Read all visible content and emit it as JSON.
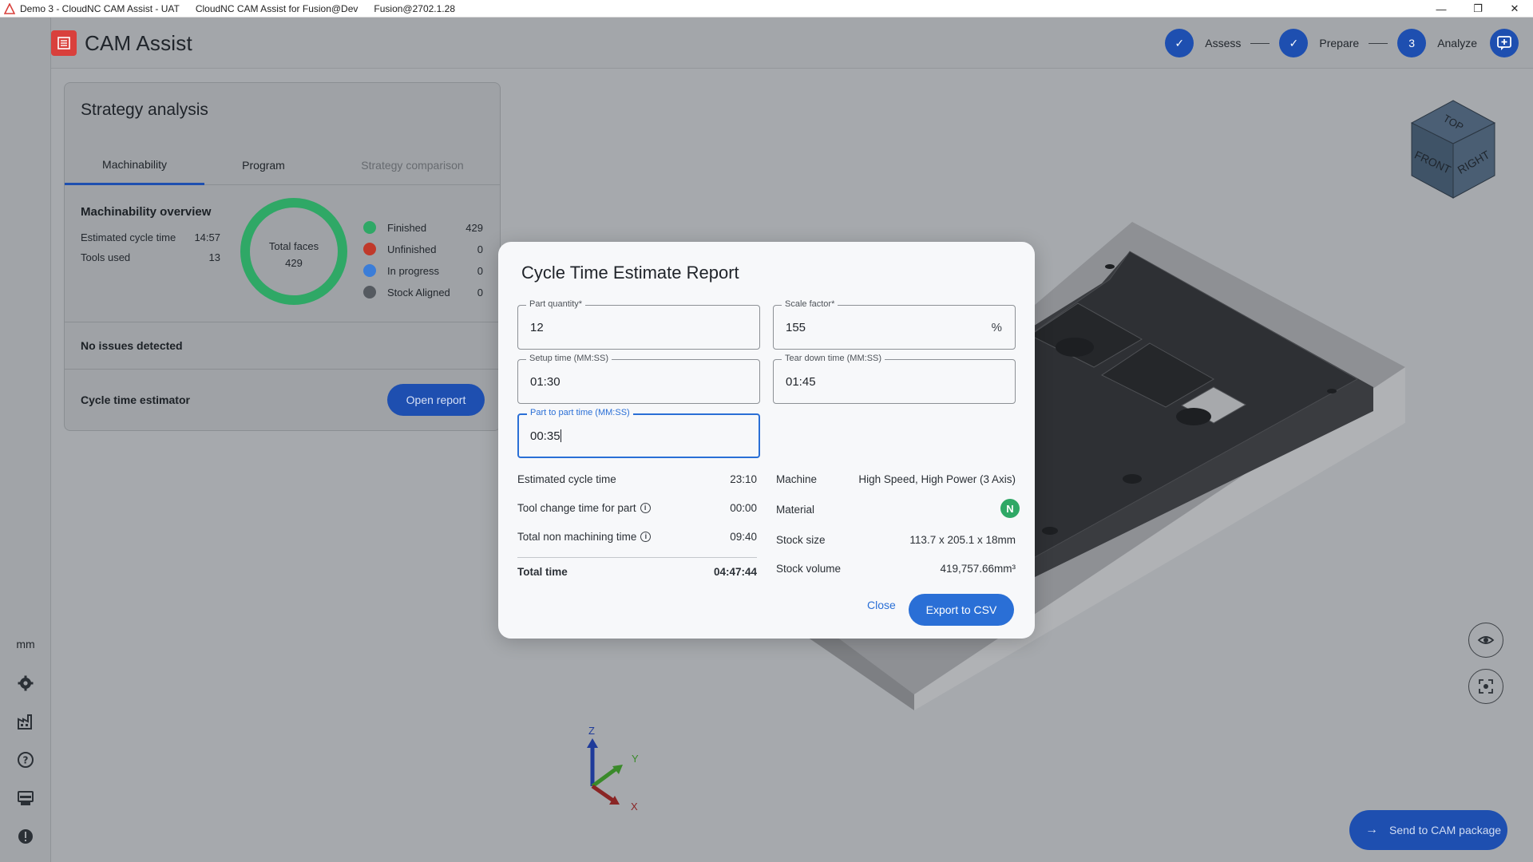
{
  "titlebar": {
    "items": [
      "Demo 3 - CloudNC CAM Assist - UAT",
      "CloudNC CAM Assist for Fusion@Dev",
      "Fusion@2702.1.28"
    ]
  },
  "app": {
    "name": "CAM Assist"
  },
  "steps": [
    {
      "label": "Assess",
      "state": "done"
    },
    {
      "label": "Prepare",
      "state": "done"
    },
    {
      "label": "Analyze",
      "number": "3",
      "state": "current"
    }
  ],
  "panel": {
    "title": "Strategy analysis",
    "tabs": [
      "Machinability",
      "Program",
      "Strategy comparison"
    ],
    "overview_title": "Machinability overview",
    "stats": [
      {
        "label": "Estimated cycle time",
        "value": "14:57"
      },
      {
        "label": "Tools used",
        "value": "13"
      }
    ],
    "donut": {
      "label": "Total faces",
      "value": "429"
    },
    "legend": [
      {
        "label": "Finished",
        "value": "429",
        "color": "#2fa866"
      },
      {
        "label": "Unfinished",
        "value": "0",
        "color": "#c0392b"
      },
      {
        "label": "In progress",
        "value": "0",
        "color": "#3b7dd8"
      },
      {
        "label": "Stock Aligned",
        "value": "0",
        "color": "#555a60"
      }
    ],
    "issues": "No issues detected",
    "estimator_label": "Cycle time estimator",
    "open_report": "Open report"
  },
  "modal": {
    "title": "Cycle Time Estimate Report",
    "fields": {
      "part_quantity": {
        "label": "Part quantity*",
        "value": "12"
      },
      "scale_factor": {
        "label": "Scale factor*",
        "value": "155",
        "suffix": "%"
      },
      "setup_time": {
        "label": "Setup time (MM:SS)",
        "value": "01:30"
      },
      "tear_down": {
        "label": "Tear down time (MM:SS)",
        "value": "01:45"
      },
      "part_to_part": {
        "label": "Part to part time (MM:SS)",
        "value": "00:35"
      }
    },
    "left_rows": [
      {
        "label": "Estimated cycle time",
        "value": "23:10"
      },
      {
        "label": "Tool change time for part",
        "value": "00:00"
      },
      {
        "label": "Total non machining time",
        "value": "09:40"
      }
    ],
    "total": {
      "label": "Total time",
      "value": "04:47:44"
    },
    "right_rows": [
      {
        "label": "Machine",
        "value": "High Speed, High Power (3 Axis)"
      },
      {
        "label": "Material",
        "badge": "N",
        "badge_color": "#2fa866"
      },
      {
        "label": "Stock size",
        "value": "113.7 x 205.1 x 18mm"
      },
      {
        "label": "Stock volume",
        "value": "419,757.66mm³"
      }
    ],
    "close": "Close",
    "export": "Export to CSV"
  },
  "viewport": {
    "unit": "mm",
    "axes": {
      "z": "Z",
      "y": "Y",
      "x": "X"
    },
    "viewcube": {
      "top": "TOP",
      "front": "FRONT",
      "right": "RIGHT"
    },
    "send": "Send to CAM package"
  }
}
